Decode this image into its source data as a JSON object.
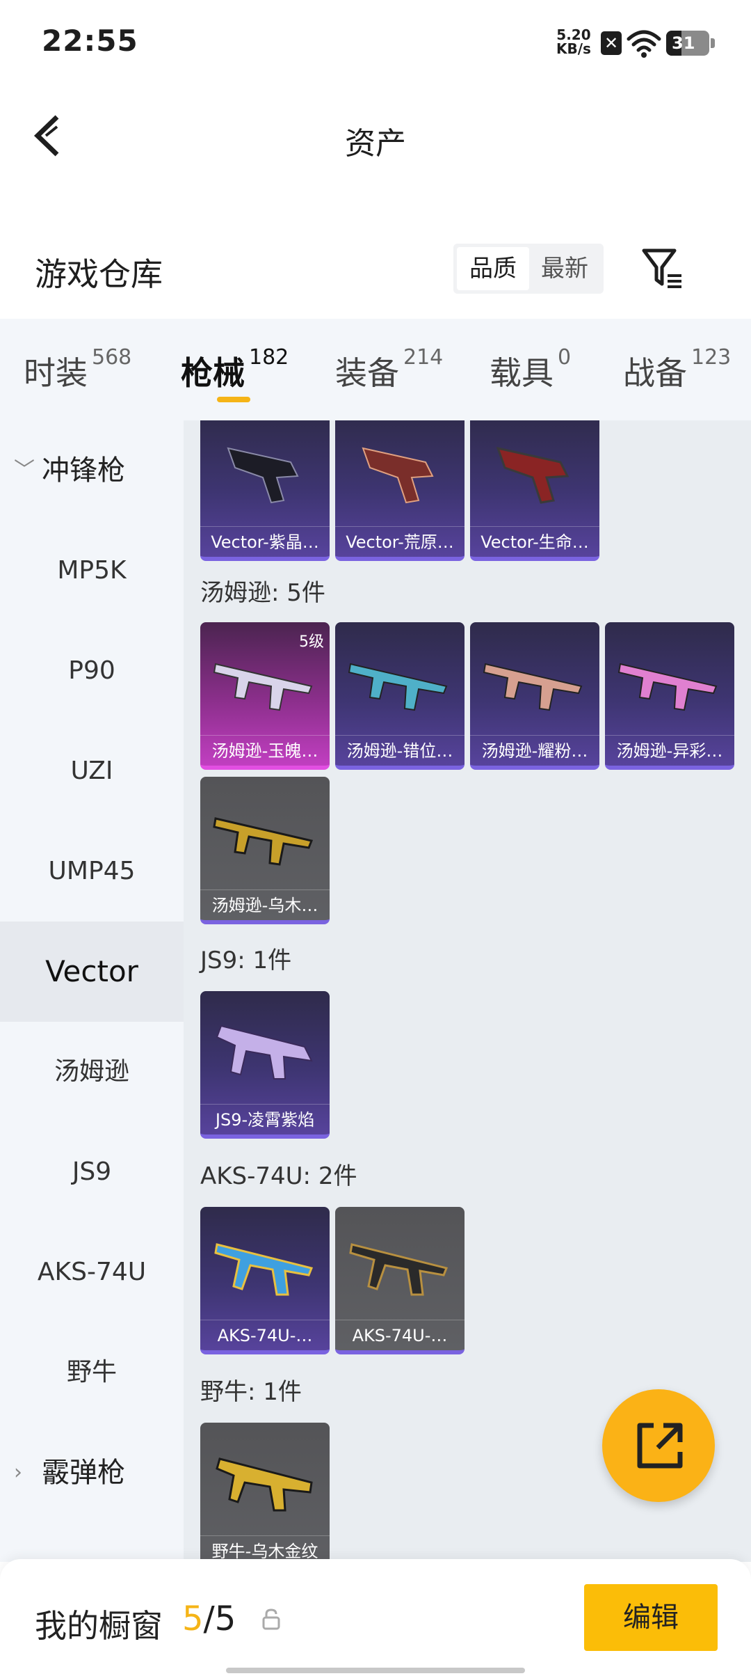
{
  "status_bar": {
    "time": "22:55",
    "speed_value": "5.20",
    "speed_unit": "KB/s",
    "battery": "31"
  },
  "nav": {
    "title": "资产"
  },
  "header": {
    "title": "游戏仓库",
    "sort_quality": "品质",
    "sort_newest": "最新"
  },
  "tabs": [
    {
      "label": "时装",
      "count": "568"
    },
    {
      "label": "枪械",
      "count": "182"
    },
    {
      "label": "装备",
      "count": "214"
    },
    {
      "label": "载具",
      "count": "0"
    },
    {
      "label": "战备",
      "count": "123"
    }
  ],
  "sidebar": {
    "category_smg": "冲锋枪",
    "items": [
      "MP5K",
      "P90",
      "UZI",
      "UMP45",
      "Vector",
      "汤姆逊",
      "JS9",
      "AKS-74U",
      "野牛"
    ],
    "selected": "Vector",
    "category_shotgun": "霰弹枪"
  },
  "content": {
    "vector_items": [
      "Vector-紫晶…",
      "Vector-荒原…",
      "Vector-生命…"
    ],
    "thompson_label": "汤姆逊: 5件",
    "thompson_items": [
      "汤姆逊-玉魄…",
      "汤姆逊-错位…",
      "汤姆逊-耀粉…",
      "汤姆逊-异彩…",
      "汤姆逊-乌木…"
    ],
    "thompson_level": "5级",
    "js9_label": "JS9: 1件",
    "js9_items": [
      "JS9-凌霄紫焰"
    ],
    "aks_label": "AKS-74U: 2件",
    "aks_items": [
      "AKS-74U-…",
      "AKS-74U-…"
    ],
    "bison_label": "野牛: 1件",
    "bison_items": [
      "野牛-乌木金纹"
    ]
  },
  "bottom": {
    "showcase_label": "我的橱窗",
    "showcase_current": "5",
    "showcase_sep": "/",
    "showcase_total": "5",
    "edit_label": "编辑"
  },
  "colors": {
    "accent": "#fbbd08",
    "card_purple": "#57439c",
    "card_pink": "#c13fc1",
    "card_gray": "#5f6064"
  }
}
